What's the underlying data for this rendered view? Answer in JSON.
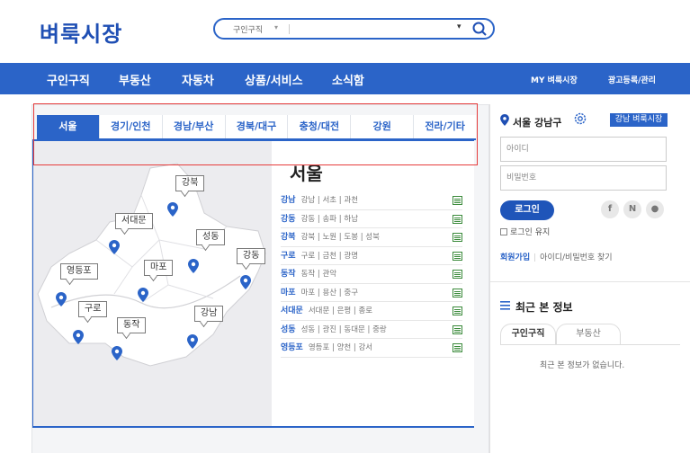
{
  "header": {
    "logo": "벼룩시장",
    "search": {
      "category": "구인구직",
      "placeholder": ""
    }
  },
  "nav": {
    "items": [
      "구인구직",
      "부동산",
      "자동차",
      "상품/서비스",
      "소식함"
    ],
    "right": [
      "MY 벼룩시장",
      "광고등록/관리"
    ]
  },
  "tabs": [
    "서울",
    "경기/인천",
    "경남/부산",
    "경북/대구",
    "충청/대전",
    "강원",
    "전라/기타"
  ],
  "map_labels": [
    "강북",
    "서대문",
    "성동",
    "강동",
    "영등포",
    "마포",
    "구로",
    "동작",
    "강남"
  ],
  "list": {
    "title": "서울",
    "rows": [
      {
        "name": "강남",
        "subs": "강남 | 서초 | 과천"
      },
      {
        "name": "강동",
        "subs": "강동 | 송파 | 하남"
      },
      {
        "name": "강북",
        "subs": "강북 | 노원 | 도봉 | 성북"
      },
      {
        "name": "구로",
        "subs": "구로 | 금천 | 광명"
      },
      {
        "name": "동작",
        "subs": "동작 | 관악"
      },
      {
        "name": "마포",
        "subs": "마포 | 용산 | 중구"
      },
      {
        "name": "서대문",
        "subs": "서대문 | 은평 | 종로"
      },
      {
        "name": "성동",
        "subs": "성동 | 광진 | 동대문 | 중랑"
      },
      {
        "name": "영등포",
        "subs": "영등포 | 양천 | 강서"
      }
    ]
  },
  "sidebar": {
    "location": "서울 강남구",
    "ad_button": "강남 벼룩시장",
    "id_placeholder": "아이디",
    "pw_placeholder": "비밀번호",
    "login": "로그인",
    "sns": [
      "f",
      "N",
      "●"
    ],
    "keep_login": "로그인 유지",
    "join": "회원가입",
    "find": "아이디/비밀번호 찾기",
    "recent_title": "최근 본 정보",
    "recent_tabs": [
      "구인구직",
      "부동산"
    ],
    "empty": "최근 본 정보가 없습니다."
  },
  "colors": {
    "brand": "#2b64c8",
    "logo": "#1f4fb4",
    "highlight": "#e63c3c"
  }
}
